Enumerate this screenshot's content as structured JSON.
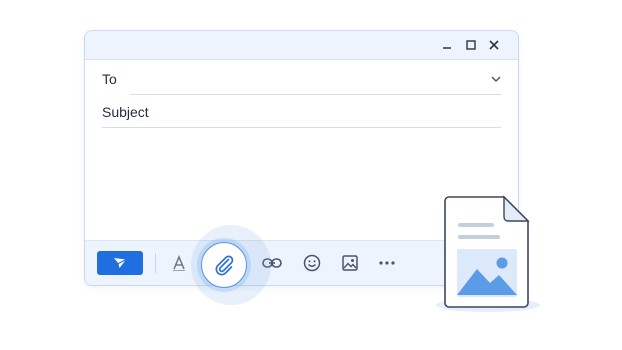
{
  "compose": {
    "to_label": "To",
    "to_value": "",
    "subject_placeholder": "Subject",
    "body_value": ""
  },
  "window_controls": [
    "minimize-icon",
    "maximize-icon",
    "close-icon"
  ],
  "toolbar": {
    "items": [
      "send-icon",
      "text-format-icon",
      "paperclip-icon",
      "link-icon",
      "emoji-icon",
      "image-icon",
      "more-icon"
    ],
    "highlighted": "paperclip-icon"
  },
  "attachment_preview": {
    "type": "image-file-icon"
  },
  "colors": {
    "accent": "#1f6fe0",
    "chrome_bg": "#eef4fd",
    "border": "#c9d9ef",
    "icon": "#4a5569",
    "file_image": "#5b9be8"
  }
}
